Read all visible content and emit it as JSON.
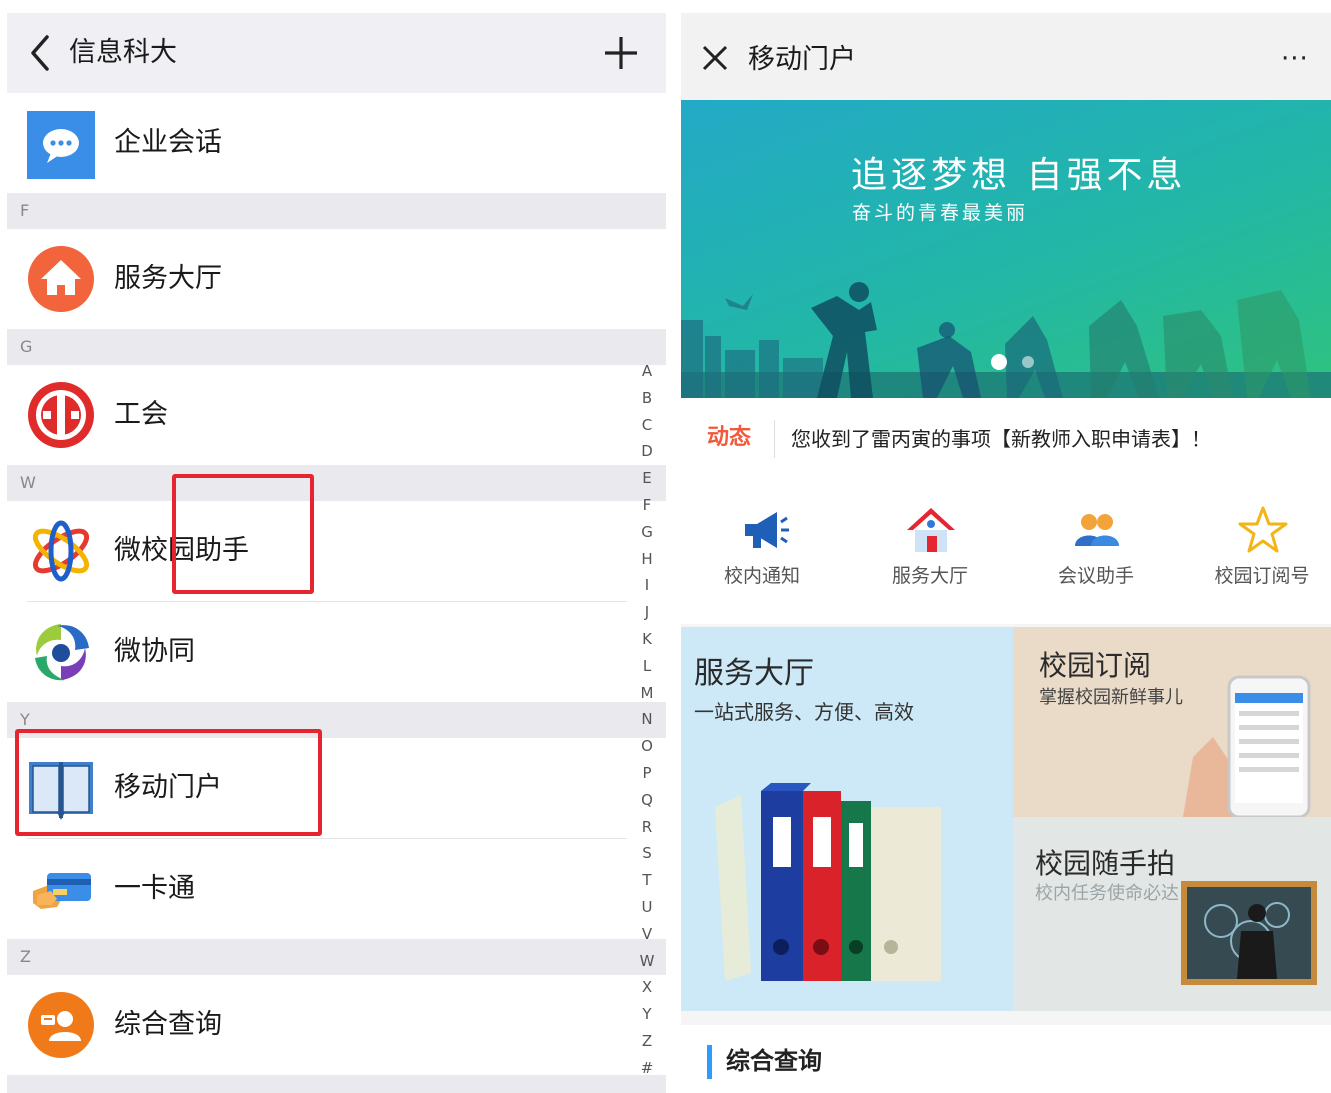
{
  "left_screen": {
    "header": {
      "title": "信息科大",
      "back_icon": "chevron-left-icon",
      "add_icon": "plus-icon"
    },
    "rows": {
      "enterprise_chat": {
        "label": "企业会话",
        "icon": "chat-bubble-icon"
      },
      "service_hall": {
        "label": "服务大厅",
        "icon": "home-icon"
      },
      "union": {
        "label": "工会",
        "icon": "trade-union-emblem-icon"
      },
      "wei_campus": {
        "label": "微校园助手",
        "icon": "atom-icon"
      },
      "wei_collab": {
        "label": "微协同",
        "icon": "swirl-icon"
      },
      "mobile_portal": {
        "label": "移动门户",
        "icon": "open-book-icon"
      },
      "campus_card": {
        "label": "一卡通",
        "icon": "card-in-hand-icon"
      },
      "general_query": {
        "label": "综合查询",
        "icon": "user-badge-icon"
      }
    },
    "sections": {
      "f": "F",
      "g": "G",
      "w": "W",
      "y": "Y",
      "z": "Z"
    },
    "index": [
      "A",
      "B",
      "C",
      "D",
      "E",
      "F",
      "G",
      "H",
      "I",
      "J",
      "K",
      "L",
      "M",
      "N",
      "O",
      "P",
      "Q",
      "R",
      "S",
      "T",
      "U",
      "V",
      "W",
      "X",
      "Y",
      "Z",
      "#"
    ]
  },
  "right_screen": {
    "header": {
      "title": "移动门户",
      "close_icon": "close-icon",
      "more_label": "···"
    },
    "banner": {
      "headline": "追逐梦想 自强不息",
      "subline": "奋斗的青春最美丽",
      "page_count": 2,
      "active_page": 1
    },
    "news": {
      "tag": "动态",
      "message": "您收到了雷丙寅的事项【新教师入职申请表】！"
    },
    "apps": [
      {
        "label": "校内通知",
        "icon": "megaphone-icon"
      },
      {
        "label": "服务大厅",
        "icon": "house-icon"
      },
      {
        "label": "会议助手",
        "icon": "people-icon"
      },
      {
        "label": "校园订阅号",
        "icon": "star-icon"
      }
    ],
    "tiles": {
      "service_hall": {
        "title": "服务大厅",
        "subtitle": "一站式服务、方便、高效"
      },
      "subscription": {
        "title": "校园订阅",
        "subtitle": "掌握校园新鲜事儿"
      },
      "snapshot": {
        "title": "校园随手拍",
        "subtitle": "校内任务使命必达"
      }
    },
    "section": {
      "title": "综合查询"
    }
  },
  "colors": {
    "highlight_border": "#e52631",
    "news_tag": "#f05a3a",
    "section_bar": "#2f9bff",
    "banner_start": "#23a9c7",
    "banner_end": "#2fc37e"
  }
}
